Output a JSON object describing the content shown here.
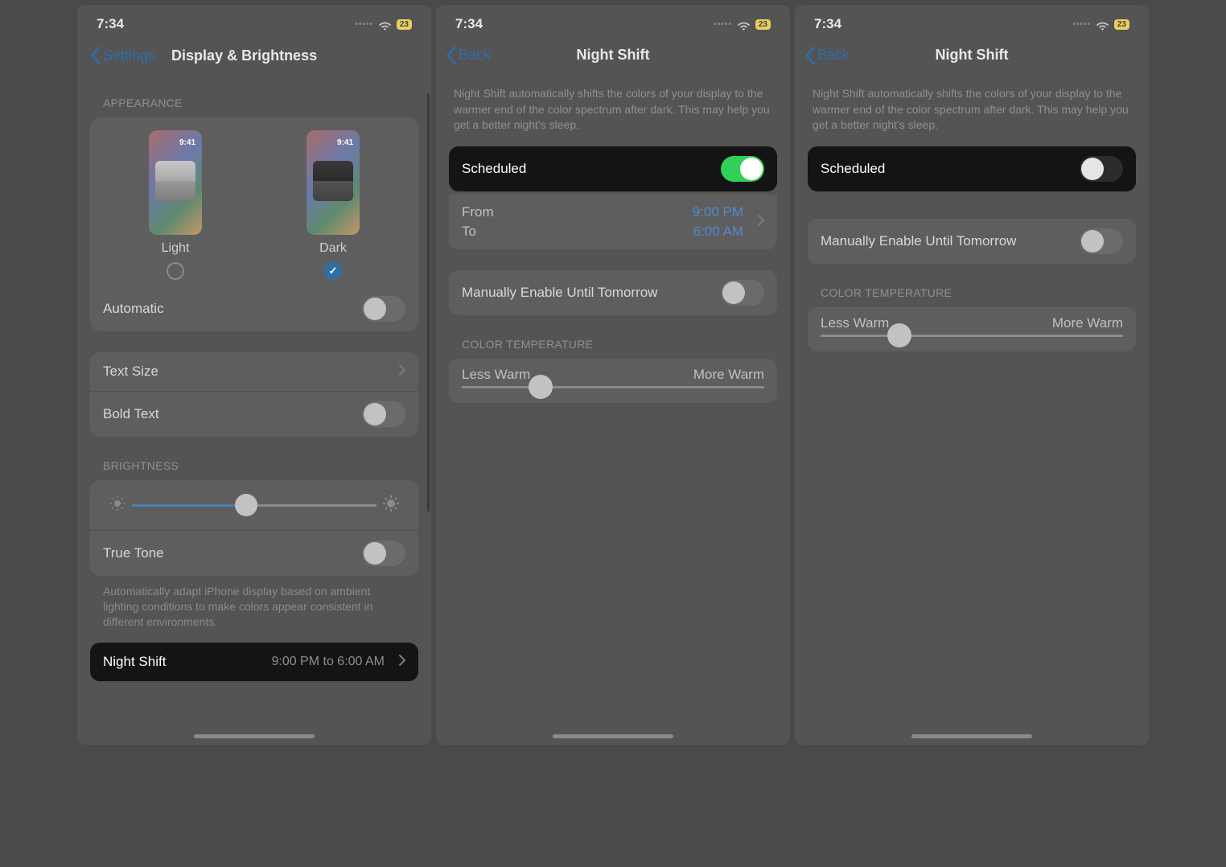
{
  "status": {
    "time": "7:34",
    "battery": "23"
  },
  "phone1": {
    "back": "Settings",
    "title": "Display & Brightness",
    "appearance_label": "APPEARANCE",
    "light": "Light",
    "dark": "Dark",
    "thumb_time": "9:41",
    "automatic": "Automatic",
    "text_size": "Text Size",
    "bold_text": "Bold Text",
    "brightness_label": "BRIGHTNESS",
    "true_tone": "True Tone",
    "true_tone_desc": "Automatically adapt iPhone display based on ambient lighting conditions to make colors appear consistent in different environments.",
    "night_shift": "Night Shift",
    "night_shift_value": "9:00 PM to 6:00 AM"
  },
  "phone2": {
    "back": "Back",
    "title": "Night Shift",
    "desc": "Night Shift automatically shifts the colors of your display to the warmer end of the color spectrum after dark. This may help you get a better night's sleep.",
    "scheduled": "Scheduled",
    "from": "From",
    "to": "To",
    "from_val": "9:00 PM",
    "to_val": "6:00 AM",
    "manual": "Manually Enable Until Tomorrow",
    "color_temp_label": "COLOR TEMPERATURE",
    "less_warm": "Less Warm",
    "more_warm": "More Warm"
  },
  "phone3": {
    "back": "Back",
    "title": "Night Shift",
    "desc": "Night Shift automatically shifts the colors of your display to the warmer end of the color spectrum after dark. This may help you get a better night's sleep.",
    "scheduled": "Scheduled",
    "manual": "Manually Enable Until Tomorrow",
    "color_temp_label": "COLOR TEMPERATURE",
    "less_warm": "Less Warm",
    "more_warm": "More Warm"
  }
}
